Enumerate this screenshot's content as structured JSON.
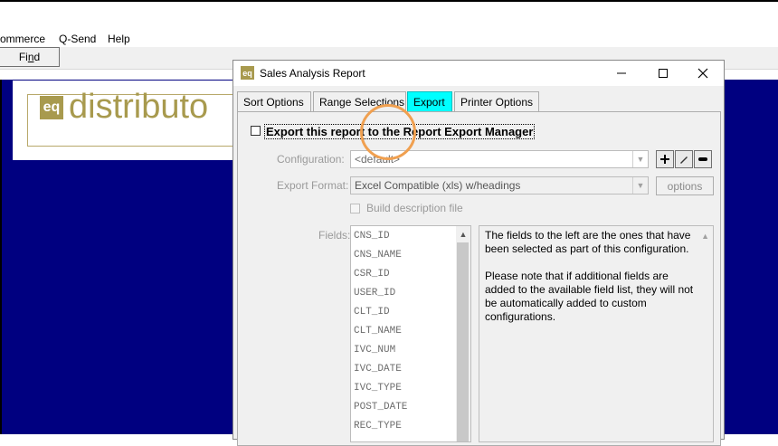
{
  "menubar": {
    "items": [
      "ommerce",
      "Q-Send",
      "Help"
    ]
  },
  "toolbar": {
    "find_prefix": "Fi",
    "find_underline": "n",
    "find_suffix": "d"
  },
  "logo": {
    "badge": "eq",
    "text": "distributo"
  },
  "dialog": {
    "icon": "eq",
    "title": "Sales Analysis Report",
    "tabs": [
      "Sort Options",
      "Range Selections",
      "Export",
      "Printer Options"
    ],
    "active_tab": "Export",
    "export_checkbox_label": "Export this report to the Report Export Manager",
    "export_checked": false,
    "configuration_label": "Configuration:",
    "configuration_value": "<default>",
    "export_format_label": "Export Format:",
    "export_format_value": "Excel Compatible (xls) w/headings",
    "options_label": "options",
    "build_description_label": "Build description file",
    "fields_label": "Fields:",
    "fields": [
      "CNS_ID",
      "CNS_NAME",
      "CSR_ID",
      "USER_ID",
      "CLT_ID",
      "CLT_NAME",
      "IVC_NUM",
      "IVC_DATE",
      "IVC_TYPE",
      "POST_DATE",
      "REC_TYPE"
    ],
    "description_p1": "The fields to the left are the ones that have been selected as part of this configuration.",
    "description_p2": "Please note that if additional fields are added to the available field list, they will not be automatically added to custom configurations."
  },
  "colors": {
    "active_tab": "#00ffff",
    "desktop": "#000080",
    "brand": "#a89a4e",
    "cursor_highlight": "#f0a050"
  },
  "icons": [
    "app-icon",
    "minimize-icon",
    "maximize-icon",
    "close-icon",
    "plus-icon",
    "pencil-icon",
    "minus-icon",
    "scroll-up-icon"
  ]
}
